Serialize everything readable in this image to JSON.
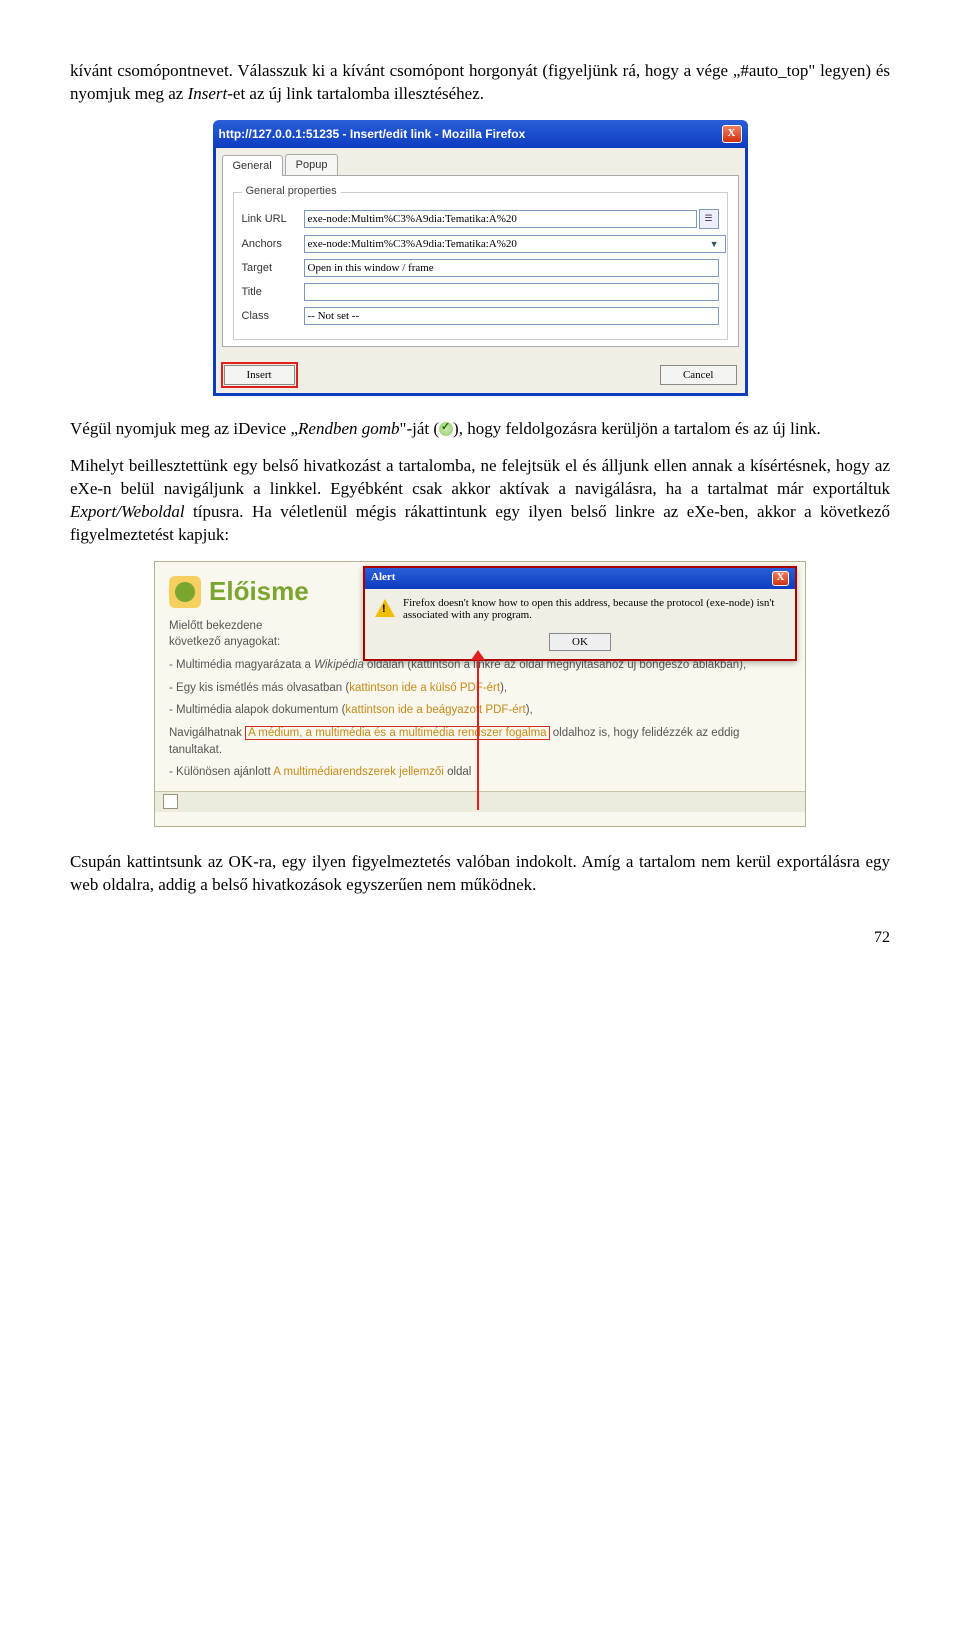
{
  "para1_a": "kívánt csomópontnevet. Válasszuk ki a kívánt csomópont horgonyát (figyeljünk rá, hogy a vége „#auto_top\" legyen) és nyomjuk meg az ",
  "para1_b": "Insert",
  "para1_c": "-et az új link tartalomba illesztéséhez.",
  "dialog": {
    "title": "http://127.0.0.1:51235 - Insert/edit link - Mozilla Firefox",
    "tab_general": "General",
    "tab_popup": "Popup",
    "legend": "General properties",
    "lbl_url": "Link URL",
    "val_url": "exe-node:Multim%C3%A9dia:Tematika:A%20",
    "lbl_anchors": "Anchors",
    "val_anchors": "exe-node:Multim%C3%A9dia:Tematika:A%20",
    "lbl_target": "Target",
    "val_target": "Open in this window / frame",
    "lbl_title": "Title",
    "val_title": "",
    "lbl_class": "Class",
    "val_class": "-- Not set --",
    "btn_insert": "Insert",
    "btn_cancel": "Cancel"
  },
  "para2_a": "Végül nyomjuk meg az iDevice „",
  "para2_b": "Rendben gomb",
  "para2_c": "\"-ját (",
  "para2_d": "), hogy feldolgozásra kerüljön a tartalom és az új link.",
  "para3_a": "Mihelyt beillesztettünk egy belső hivatkozást a tartalomba, ne felejtsük el és álljunk ellen annak a kísértésnek, hogy az eXe-n belül navigáljunk a linkkel. Egyébként csak akkor aktívak a navigálásra, ha a tartalmat már exportáltuk ",
  "para3_b": "Export/Weboldal",
  "para3_c": " típusra. Ha véletlenül mégis rákattintunk egy ilyen belső linkre az eXe-ben, akkor a következő figyelmeztetést kapjuk:",
  "shot2": {
    "heading": "Előisme",
    "alert_title": "Alert",
    "alert_msg": "Firefox doesn't know how to open this address, because the protocol (exe-node) isn't associated with any program.",
    "alert_ok": "OK",
    "l1a": "Mielőtt bekezdene ",
    "l1b": "következő anyagokat:",
    "b1a": "- Multimédia magyarázata a ",
    "b1b": "Wikipédia",
    "b1c": " oldalán (kattintson a linkre az oldal megnyitásához új böngésző ablakban),",
    "b2a": "- Egy kis ismétlés más olvasatban (",
    "b2b": "kattintson ide a külső PDF-ért",
    "b2c": "),",
    "b3a": "- Multimédia alapok dokumentum (",
    "b3b": "kattintson ide a beágyazott PDF-ért",
    "b3c": "),",
    "b4a": "Navigálhatnak ",
    "b4b": "A médium, a multimédia és a multimédia rendszer fogalma",
    "b4c": " oldalhoz is, hogy felidézzék az eddig tanultakat.",
    "b5a": "- Különösen ajánlott ",
    "b5b": "A multimédiarendszerek jellemzői",
    "b5c": " oldal"
  },
  "para4": "Csupán kattintsunk az OK-ra, egy ilyen figyelmeztetés valóban indokolt. Amíg a tartalom nem kerül exportálásra egy web oldalra, addig a belső hivatkozások egyszerűen nem működnek.",
  "page": "72"
}
